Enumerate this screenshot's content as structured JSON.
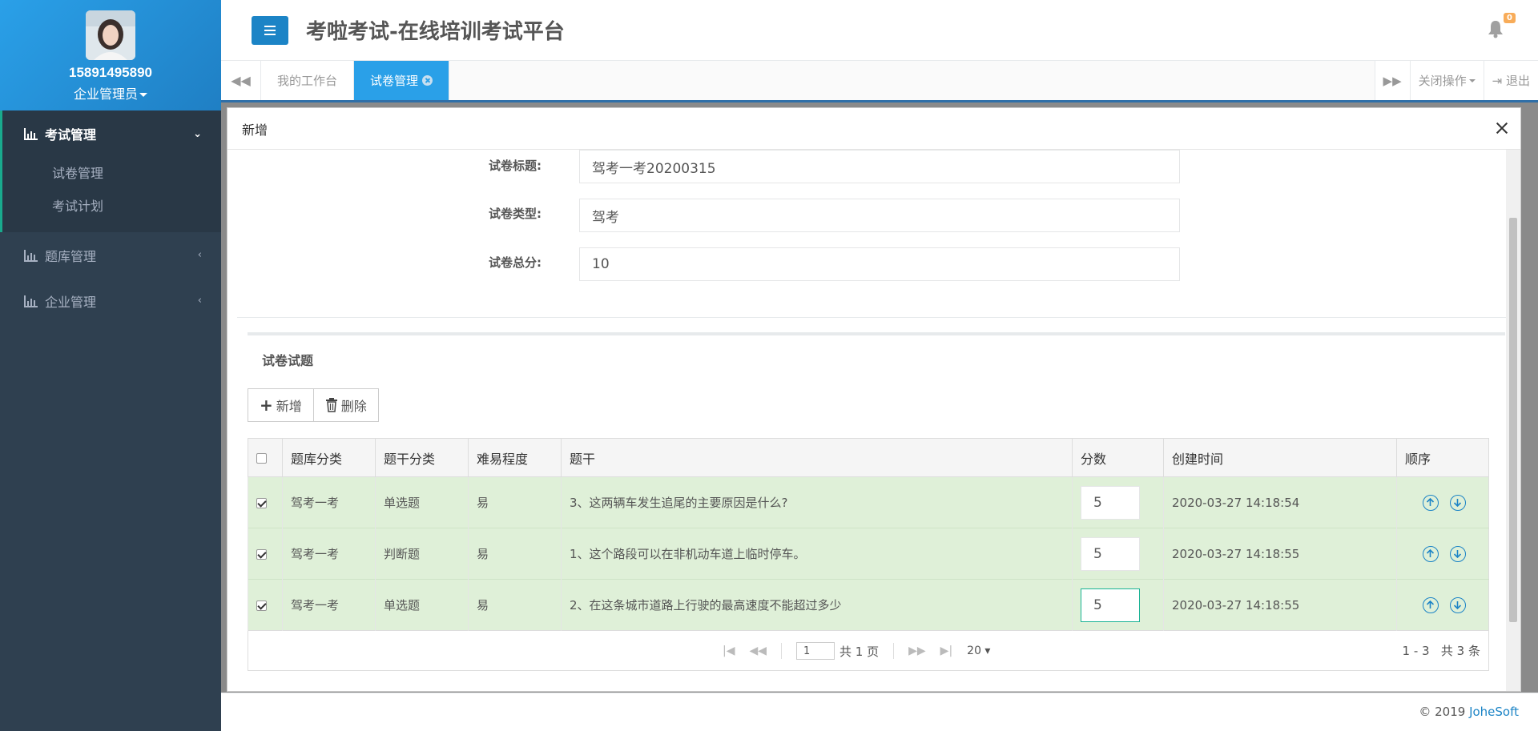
{
  "profile": {
    "phone": "15891495890",
    "role": "企业管理员"
  },
  "sidebar": {
    "groups": [
      {
        "label": "考试管理",
        "items": [
          {
            "label": "试卷管理"
          },
          {
            "label": "考试计划"
          }
        ]
      },
      {
        "label": "题库管理"
      },
      {
        "label": "企业管理"
      }
    ]
  },
  "header": {
    "title": "考啦考试-在线培训考试平台",
    "notification_count": "0"
  },
  "tabs": {
    "items": [
      {
        "label": "我的工作台"
      },
      {
        "label": "试卷管理"
      }
    ],
    "close_ops": "关闭操作",
    "logout": "退出"
  },
  "dialog": {
    "title": "新增",
    "form": {
      "title_label": "试卷标题:",
      "title_value": "驾考一考20200315",
      "type_label": "试卷类型:",
      "type_value": "驾考",
      "score_label": "试卷总分:",
      "score_value": "10"
    },
    "questions": {
      "section_title": "试卷试题",
      "add_label": "新增",
      "delete_label": "删除",
      "columns": [
        "题库分类",
        "题干分类",
        "难易程度",
        "题干",
        "分数",
        "创建时间",
        "顺序"
      ],
      "rows": [
        {
          "bank": "驾考一考",
          "type": "单选题",
          "difficulty": "易",
          "stem": "3、这两辆车发生追尾的主要原因是什么?",
          "score": "5",
          "created": "2020-03-27 14:18:54"
        },
        {
          "bank": "驾考一考",
          "type": "判断题",
          "difficulty": "易",
          "stem": "1、这个路段可以在非机动车道上临时停车。",
          "score": "5",
          "created": "2020-03-27 14:18:55"
        },
        {
          "bank": "驾考一考",
          "type": "单选题",
          "difficulty": "易",
          "stem": "2、在这条城市道路上行驶的最高速度不能超过多少",
          "score": "5",
          "created": "2020-03-27 14:18:55"
        }
      ],
      "pager": {
        "page": "1",
        "total_pages_text": "共 1 页",
        "page_size": "20",
        "range_text": "1 - 3",
        "total_text": "共 3 条"
      }
    }
  },
  "footer": {
    "copyright": "© 2019 ",
    "company": "JoheSoft"
  },
  "colors": {
    "accent": "#2aa0e8",
    "sidebar_bg": "#2f4050",
    "selected_row": "#dff0d8",
    "focus_border": "#1ab394"
  }
}
